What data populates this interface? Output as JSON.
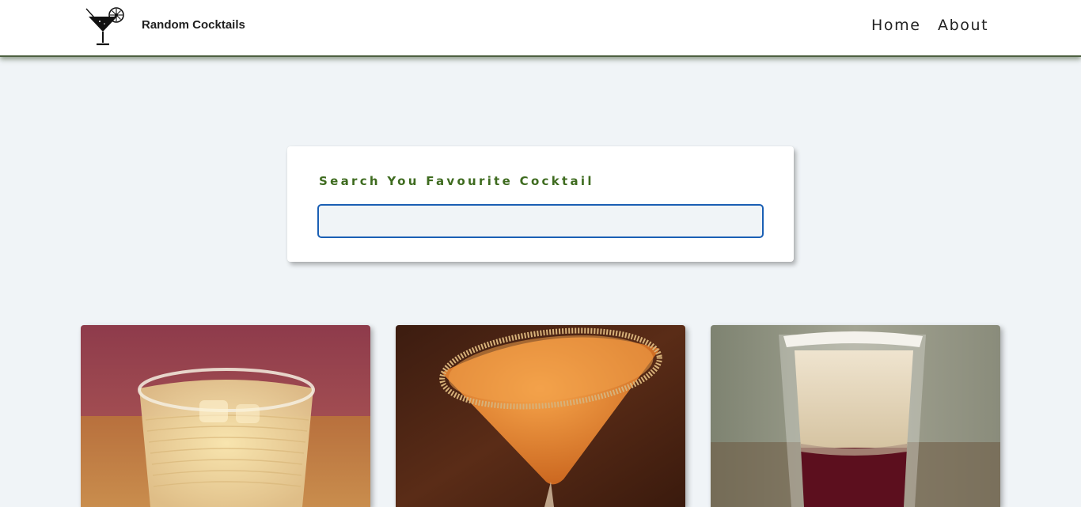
{
  "navbar": {
    "logo_icon": "martini-glass-with-lime-icon",
    "brand": "Random Cocktails",
    "links": [
      {
        "label": "Home"
      },
      {
        "label": "About"
      }
    ]
  },
  "search": {
    "label": "Search You Favourite Cocktail",
    "value": "",
    "placeholder": "",
    "focus_color": "#1a5fb4",
    "label_color": "#3e6b1f"
  },
  "cocktails": [
    {
      "image": "whiskey-rocks-glass-photo"
    },
    {
      "image": "sugar-rimmed-orange-martini-photo"
    },
    {
      "image": "layered-cream-shot-photo"
    }
  ],
  "colors": {
    "page_background": "#f0f4f7",
    "navbar_border": "#4d6040"
  }
}
